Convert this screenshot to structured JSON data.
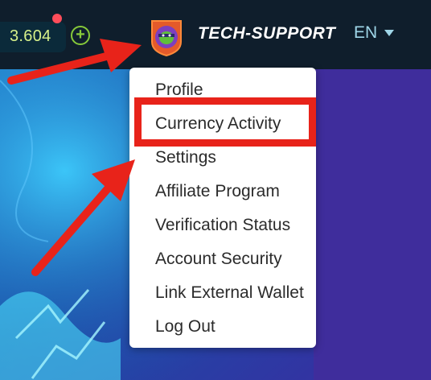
{
  "header": {
    "balance": "3.604",
    "username": "TECH-SUPPORT",
    "language": "EN"
  },
  "menu": {
    "items": [
      "Profile",
      "Currency Activity",
      "Settings",
      "Affiliate Program",
      "Verification Status",
      "Account Security",
      "Link External Wallet",
      "Log Out"
    ]
  },
  "colors": {
    "header_bg": "#0f1e2c",
    "balance_text": "#d7f08a",
    "plus_green": "#86c93a",
    "notification": "#ff4d5a",
    "annotation_red": "#e8231a",
    "lang_text": "#9fd6e8"
  },
  "icons": {
    "add": "plus-circle-icon",
    "avatar": "ninja-turtle-avatar",
    "language": "chevron-down-icon"
  }
}
